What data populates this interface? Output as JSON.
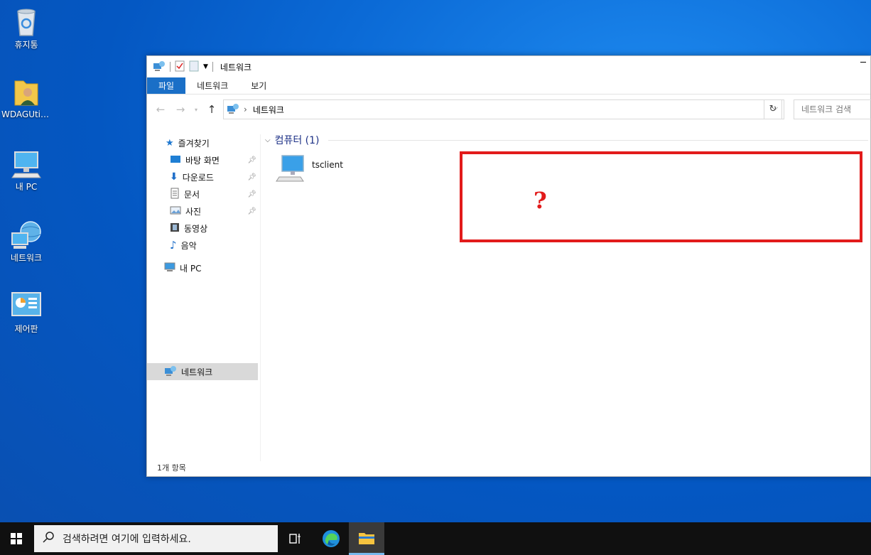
{
  "desktop": {
    "icons": [
      {
        "label": "휴지통",
        "icon": "recycle-bin-icon"
      },
      {
        "label": "WDAGUtili...",
        "icon": "user-folder-icon"
      },
      {
        "label": "내 PC",
        "icon": "this-pc-icon"
      },
      {
        "label": "네트워크",
        "icon": "network-icon"
      },
      {
        "label": "제어판",
        "icon": "control-panel-icon"
      }
    ]
  },
  "window": {
    "title": "네트워크",
    "ribbon_tabs": [
      "파일",
      "네트워크",
      "보기"
    ],
    "address": {
      "crumb": "네트워크"
    },
    "search_placeholder": "네트워크 검색",
    "nav": {
      "quick_access": "즐겨찾기",
      "items": [
        "바탕 화면",
        "다운로드",
        "문서",
        "사진",
        "동영상",
        "음악"
      ],
      "this_pc": "내 PC",
      "network": "네트워크"
    },
    "group_header": "컴퓨터 (1)",
    "items": [
      {
        "name": "tsclient",
        "icon": "computer-icon"
      }
    ],
    "annotation": "?",
    "status": "1개 항목"
  },
  "taskbar": {
    "search_placeholder": "검색하려면 여기에 입력하세요."
  },
  "colors": {
    "accent": "#1a6fc7",
    "annotation_red": "#e21b1b",
    "group_header": "#1e3287"
  }
}
